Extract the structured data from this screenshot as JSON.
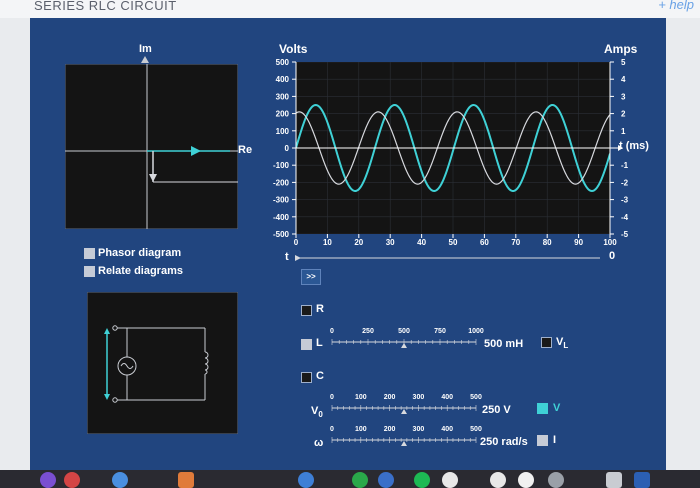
{
  "app": {
    "title": "SERIES RLC CIRCUIT",
    "help": "+ help"
  },
  "phasor": {
    "im": "Im",
    "re": "Re"
  },
  "options": {
    "phasor_diagram": "Phasor diagram",
    "relate_diagrams": "Relate diagrams"
  },
  "graph": {
    "left_axis_title": "Volts",
    "right_axis_title": "Amps",
    "t_axis_title": "t (ms)",
    "left_ticks": [
      "500",
      "400",
      "300",
      "200",
      "100",
      "0",
      "-100",
      "-200",
      "-300",
      "-400",
      "-500"
    ],
    "right_ticks": [
      "5",
      "4",
      "3",
      "2",
      "1",
      "-1",
      "-2",
      "-3",
      "-4",
      "-5"
    ],
    "x_ticks": [
      "0",
      "10",
      "20",
      "30",
      "40",
      "50",
      "60",
      "70",
      "80",
      "90",
      "100"
    ]
  },
  "time_slider": {
    "label": "t",
    "end_value": "0",
    "play": ">>"
  },
  "components": {
    "r": "R",
    "l": "L",
    "c": "C"
  },
  "sliders": {
    "l": {
      "ticks": [
        "0",
        "250",
        "500",
        "750",
        "1000"
      ],
      "value": "500 mH",
      "check_label": "V",
      "check_sub": "L"
    },
    "v": {
      "label": "V",
      "sub": "0",
      "ticks": [
        "0",
        "100",
        "200",
        "300",
        "400",
        "500"
      ],
      "value": "250 V",
      "check_label": "V"
    },
    "w": {
      "label": "ω",
      "ticks": [
        "0",
        "100",
        "200",
        "300",
        "400",
        "500"
      ],
      "value": "250 rad/s",
      "check_label": "I"
    }
  },
  "colors": {
    "panel": "#21457f",
    "voltage": "#3fd1d6",
    "current": "#d7d9de",
    "plot_bg": "#141414"
  },
  "chart_data": {
    "type": "line",
    "title": "",
    "xlabel": "t (ms)",
    "ylabel": "Volts",
    "y2label": "Amps",
    "xlim": [
      0,
      100
    ],
    "ylim": [
      -500,
      500
    ],
    "y2lim": [
      -5,
      5
    ],
    "series": [
      {
        "name": "",
        "axis": "left",
        "color": "#3fd1d6",
        "amplitude": 250,
        "angular_frequency_rad_per_s": 250,
        "phase_rad": 1.57
      },
      {
        "name": "",
        "axis": "right",
        "color": "#d7d9de",
        "amplitude": 2.1,
        "angular_frequency_rad_per_s": 250,
        "phase_rad": 0.26
      }
    ]
  }
}
